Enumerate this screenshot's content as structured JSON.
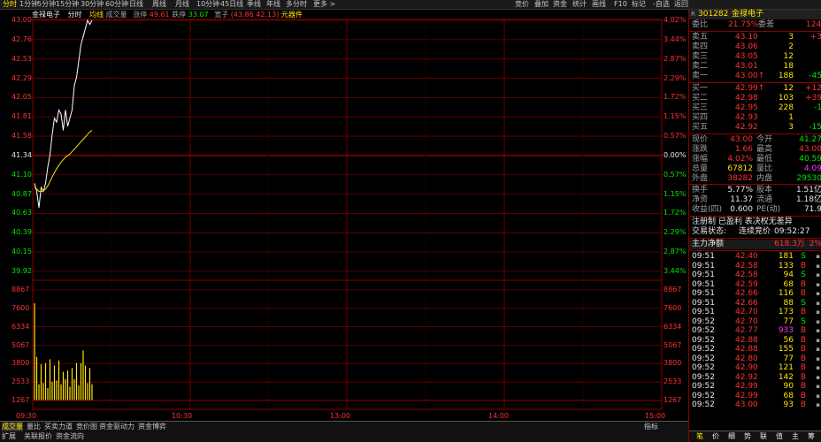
{
  "topbar": {
    "tabs": [
      "分时",
      "1分钟",
      "5分钟",
      "15分钟",
      "30分钟",
      "60分钟",
      "日线",
      "周线",
      "月线",
      "10分钟",
      "45日线",
      "季线",
      "年线",
      "多分时",
      "更多 >"
    ],
    "right_buttons": [
      "竞价",
      "叠加",
      "资金",
      "统计",
      "画线",
      "F10",
      "标记",
      "-自选",
      "返回"
    ]
  },
  "chart": {
    "name": "金禄电子",
    "mode": "分时",
    "indicator": "均线",
    "vol_label": "成交量",
    "up_label": "涨停",
    "up_value": "49.61",
    "down_label": "跌停",
    "down_value": "33.07",
    "sector_label": "宽子",
    "sector_value": "(43.86 42.13)",
    "sector_name": "元器件",
    "price_labels": [
      "43.00",
      "42.76",
      "42.53",
      "42.29",
      "42.05",
      "41.81",
      "41.58",
      "41.34",
      "41.10",
      "40.87",
      "40.63",
      "40.39",
      "40.15",
      "39.92"
    ],
    "pct_labels": [
      "4.02%",
      "3.44%",
      "2.87%",
      "2.29%",
      "1.72%",
      "1.15%",
      "0.57%",
      "0.00%",
      "0.57%",
      "1.15%",
      "1.72%",
      "2.29%",
      "2.87%",
      "3.44%"
    ],
    "vol_labels": [
      "8867",
      "7600",
      "6334",
      "5067",
      "3800",
      "2533",
      "1267"
    ],
    "time_labels": [
      "09:30",
      "10:30",
      "13:00",
      "14:00",
      "15:00"
    ],
    "prev_close": 41.34
  },
  "chart_data": {
    "type": "line",
    "series": [
      {
        "name": "分时",
        "values": [
          41.0,
          40.9,
          40.7,
          40.95,
          40.9,
          41.0,
          41.2,
          41.35,
          41.6,
          41.8,
          41.75,
          41.9,
          41.85,
          41.65,
          41.9,
          41.7,
          41.8,
          41.9,
          42.2,
          42.3,
          42.5,
          42.7,
          42.8,
          42.9,
          43.0,
          42.95,
          43.0
        ]
      },
      {
        "name": "均线",
        "values": [
          40.95,
          40.93,
          40.9,
          40.9,
          40.91,
          40.93,
          40.97,
          41.02,
          41.08,
          41.13,
          41.18,
          41.22,
          41.26,
          41.29,
          41.32,
          41.34,
          41.36,
          41.39,
          41.42,
          41.45,
          41.48,
          41.51,
          41.54,
          41.57,
          41.6,
          41.63,
          41.65
        ]
      }
    ],
    "volumes": [
      7800,
      3500,
      1300,
      2900,
      1400,
      3000,
      1000,
      3300,
      1500,
      2800,
      1600,
      3200,
      1300,
      2300,
      1700,
      2400,
      1100,
      2600,
      1700,
      3000,
      1200,
      3000,
      4000,
      2800,
      1400,
      2600,
      1300
    ],
    "ylim": [
      39.92,
      43.0
    ],
    "vol_ylim": [
      0,
      8867
    ]
  },
  "right": {
    "code": "301282",
    "name": "金禄电子",
    "weibi_label": "委比",
    "weibi_value": "21.75%",
    "weicha_label": "委差",
    "weicha_value": "124",
    "asks": [
      {
        "label": "卖五",
        "price": "43.10",
        "vol": "3",
        "chg": "+3"
      },
      {
        "label": "卖四",
        "price": "43.06",
        "vol": "2",
        "chg": ""
      },
      {
        "label": "卖三",
        "price": "43.05",
        "vol": "12",
        "chg": ""
      },
      {
        "label": "卖二",
        "price": "43.01",
        "vol": "18",
        "chg": ""
      },
      {
        "label": "卖一",
        "price": "43.00↑",
        "vol": "188",
        "chg": "-45"
      }
    ],
    "bids": [
      {
        "label": "买一",
        "price": "42.99↑",
        "vol": "12",
        "chg": "+12"
      },
      {
        "label": "买二",
        "price": "42.98",
        "vol": "103",
        "chg": "+39"
      },
      {
        "label": "买三",
        "price": "42.95",
        "vol": "228",
        "chg": "-1"
      },
      {
        "label": "买四",
        "price": "42.93",
        "vol": "1",
        "chg": ""
      },
      {
        "label": "买五",
        "price": "42.92",
        "vol": "3",
        "chg": "-15"
      }
    ],
    "quote": [
      {
        "l1": "现价",
        "v1": "43.00",
        "l2": "今开",
        "v2": "41.27",
        "c1": "red",
        "c2": "grn"
      },
      {
        "l1": "涨跌",
        "v1": "1.66",
        "l2": "最高",
        "v2": "43.00",
        "c1": "red",
        "c2": "red"
      },
      {
        "l1": "涨幅",
        "v1": "4.02%",
        "l2": "最低",
        "v2": "40.59",
        "c1": "red",
        "c2": "grn"
      },
      {
        "l1": "总量",
        "v1": "67812",
        "l2": "量比",
        "v2": "4.09",
        "c1": "yel",
        "c2": "mag"
      },
      {
        "l1": "外盘",
        "v1": "38282",
        "l2": "内盘",
        "v2": "29530",
        "c1": "red",
        "c2": "grn"
      },
      {
        "l1": "换手",
        "v1": "5.77%",
        "l2": "股本",
        "v2": "1.51亿",
        "c1": "wht",
        "c2": "wht"
      },
      {
        "l1": "净资",
        "v1": "11.37",
        "l2": "流通",
        "v2": "1.18亿",
        "c1": "wht",
        "c2": "wht"
      },
      {
        "l1": "收益(四)",
        "v1": "0.600",
        "l2": "PE(动)",
        "v2": "71.9",
        "c1": "wht",
        "c2": "wht"
      }
    ],
    "info1": "注册制 已盈利 表决权无差异",
    "info2_label": "交易状态:",
    "info2_value": "连续竞价",
    "info2_time": "09:52:27",
    "net_label": "主力净额",
    "net_value": "618.3万",
    "net_pct": "2%",
    "ticks": [
      {
        "t": "09:51",
        "p": "42.40",
        "v": "181",
        "s": "S",
        "vc": "yel",
        "sc": "grn"
      },
      {
        "t": "09:51",
        "p": "42.58",
        "v": "133",
        "s": "B",
        "vc": "yel",
        "sc": "red"
      },
      {
        "t": "09:51",
        "p": "42.58",
        "v": "94",
        "s": "S",
        "vc": "yel",
        "sc": "grn"
      },
      {
        "t": "09:51",
        "p": "42.59",
        "v": "68",
        "s": "B",
        "vc": "yel",
        "sc": "red"
      },
      {
        "t": "09:51",
        "p": "42.66",
        "v": "116",
        "s": "B",
        "vc": "yel",
        "sc": "red"
      },
      {
        "t": "09:51",
        "p": "42.66",
        "v": "88",
        "s": "S",
        "vc": "yel",
        "sc": "grn"
      },
      {
        "t": "09:51",
        "p": "42.70",
        "v": "173",
        "s": "B",
        "vc": "yel",
        "sc": "red"
      },
      {
        "t": "09:52",
        "p": "42.70",
        "v": "77",
        "s": "S",
        "vc": "yel",
        "sc": "grn"
      },
      {
        "t": "09:52",
        "p": "42.77",
        "v": "933",
        "s": "B",
        "vc": "mag",
        "sc": "red"
      },
      {
        "t": "09:52",
        "p": "42.88",
        "v": "56",
        "s": "B",
        "vc": "yel",
        "sc": "red"
      },
      {
        "t": "09:52",
        "p": "42.88",
        "v": "155",
        "s": "B",
        "vc": "yel",
        "sc": "red"
      },
      {
        "t": "09:52",
        "p": "42.80",
        "v": "77",
        "s": "B",
        "vc": "yel",
        "sc": "red"
      },
      {
        "t": "09:52",
        "p": "42.90",
        "v": "121",
        "s": "B",
        "vc": "yel",
        "sc": "red"
      },
      {
        "t": "09:52",
        "p": "42.92",
        "v": "142",
        "s": "B",
        "vc": "yel",
        "sc": "red"
      },
      {
        "t": "09:52",
        "p": "42.99",
        "v": "90",
        "s": "B",
        "vc": "yel",
        "sc": "red"
      },
      {
        "t": "09:52",
        "p": "42.99",
        "v": "68",
        "s": "B",
        "vc": "yel",
        "sc": "red"
      },
      {
        "t": "09:52",
        "p": "43.00",
        "v": "93",
        "s": "B",
        "vc": "yel",
        "sc": "red"
      }
    ],
    "footer_tabs": [
      "笔",
      "价",
      "细",
      "势",
      "联",
      "值",
      "主",
      "筹"
    ]
  },
  "bottom": {
    "row1": [
      "成交量",
      "量比",
      "买卖力道",
      "竞价图",
      "资金驱动力",
      "资金博弈"
    ],
    "row1_right": [
      "指标"
    ],
    "row2": [
      "扩展",
      "关联报价",
      "资金流向"
    ]
  }
}
